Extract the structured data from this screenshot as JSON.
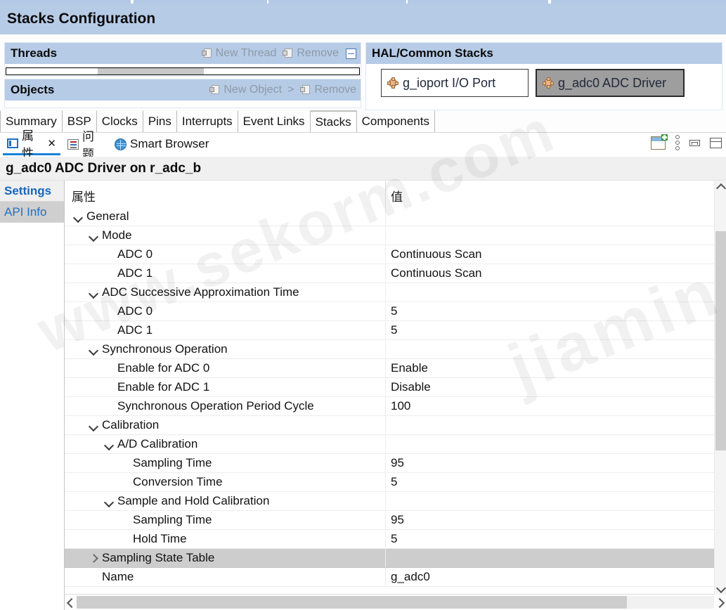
{
  "window": {
    "stacks_config_title": "Stacks Configuration"
  },
  "threads_panel": {
    "title": "Threads",
    "new_label": "New Thread",
    "remove_label": "Remove",
    "new_icon": "new-thread-icon",
    "remove_icon": "remove-icon",
    "collapse_icon": "collapse-icon"
  },
  "objects_panel": {
    "title": "Objects",
    "new_label": "New Object",
    "chevron": ">",
    "remove_label": "Remove",
    "new_icon": "new-object-icon",
    "remove_icon": "remove-icon"
  },
  "hal_panel": {
    "title": "HAL/Common Stacks",
    "stacks": [
      {
        "label": "g_ioport I/O Port",
        "icon": "module-icon",
        "selected": false
      },
      {
        "label": "g_adc0 ADC Driver",
        "icon": "module-icon",
        "selected": true
      }
    ]
  },
  "editor_tabs": [
    {
      "label": "Summary",
      "active": false
    },
    {
      "label": "BSP",
      "active": false
    },
    {
      "label": "Clocks",
      "active": false
    },
    {
      "label": "Pins",
      "active": false
    },
    {
      "label": "Interrupts",
      "active": false
    },
    {
      "label": "Event Links",
      "active": false
    },
    {
      "label": "Stacks",
      "active": true
    },
    {
      "label": "Components",
      "active": false
    }
  ],
  "view_tabs": [
    {
      "label": "属性",
      "icon": "properties-icon",
      "active": true,
      "closable": true,
      "close_glyph": "✕"
    },
    {
      "label": "问题",
      "icon": "problems-icon",
      "active": false,
      "closable": false
    },
    {
      "label": "Smart Browser",
      "icon": "smart-browser-icon",
      "active": false,
      "closable": false
    }
  ],
  "view_tools": [
    {
      "name": "new-view-icon"
    },
    {
      "name": "view-menu-icon"
    },
    {
      "name": "minimize-icon"
    },
    {
      "name": "maximize-icon"
    }
  ],
  "properties": {
    "title": "g_adc0 ADC Driver on r_adc_b",
    "side_nav": [
      {
        "label": "Settings",
        "active": true
      },
      {
        "label": "API Info",
        "active": false
      }
    ],
    "columns": {
      "property": "属性",
      "value": "值"
    },
    "rows": [
      {
        "label": "General",
        "value": "",
        "indent": 1,
        "twisty": "open"
      },
      {
        "label": "Mode",
        "value": "",
        "indent": 2,
        "twisty": "open"
      },
      {
        "label": "ADC 0",
        "value": "Continuous Scan",
        "indent": 3,
        "twisty": "none"
      },
      {
        "label": "ADC 1",
        "value": "Continuous Scan",
        "indent": 3,
        "twisty": "none"
      },
      {
        "label": "ADC Successive Approximation Time",
        "value": "",
        "indent": 2,
        "twisty": "open"
      },
      {
        "label": "ADC 0",
        "value": "5",
        "indent": 3,
        "twisty": "none"
      },
      {
        "label": "ADC 1",
        "value": "5",
        "indent": 3,
        "twisty": "none"
      },
      {
        "label": "Synchronous Operation",
        "value": "",
        "indent": 2,
        "twisty": "open"
      },
      {
        "label": "Enable for ADC 0",
        "value": "Enable",
        "indent": 3,
        "twisty": "none"
      },
      {
        "label": "Enable for ADC 1",
        "value": "Disable",
        "indent": 3,
        "twisty": "none"
      },
      {
        "label": "Synchronous Operation Period Cycle",
        "value": "100",
        "indent": 3,
        "twisty": "none"
      },
      {
        "label": "Calibration",
        "value": "",
        "indent": 2,
        "twisty": "open"
      },
      {
        "label": "A/D Calibration",
        "value": "",
        "indent": 3,
        "twisty": "open"
      },
      {
        "label": "Sampling Time",
        "value": "95",
        "indent": 4,
        "twisty": "none"
      },
      {
        "label": "Conversion Time",
        "value": "5",
        "indent": 4,
        "twisty": "none"
      },
      {
        "label": "Sample and Hold Calibration",
        "value": "",
        "indent": 3,
        "twisty": "open"
      },
      {
        "label": "Sampling Time",
        "value": "95",
        "indent": 4,
        "twisty": "none"
      },
      {
        "label": "Hold Time",
        "value": "5",
        "indent": 4,
        "twisty": "none"
      },
      {
        "label": "Sampling State Table",
        "value": "",
        "indent": 2,
        "twisty": "closed",
        "selected": true
      },
      {
        "label": "Name",
        "value": "g_adc0",
        "indent": 2,
        "twisty": "none"
      }
    ]
  },
  "watermark": {
    "main": "www.sekorm.com",
    "cjk": "jiamin_mo&&莫"
  },
  "colors": {
    "header_blue": "#b6cbe6",
    "accent_blue": "#1c7fd6",
    "selection_gray": "#cdcdcd",
    "link_blue": "#1c72c4"
  }
}
